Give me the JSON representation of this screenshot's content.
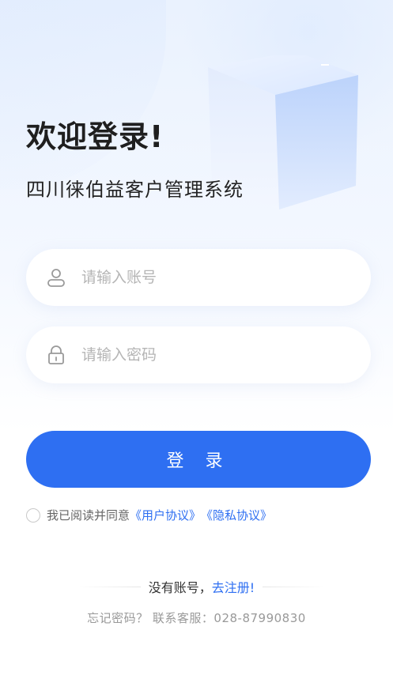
{
  "header": {
    "welcome": "欢迎登录!",
    "subtitle": "四川徕伯益客户管理系统"
  },
  "form": {
    "account": {
      "placeholder": "请输入账号",
      "icon": "user-icon"
    },
    "password": {
      "placeholder": "请输入密码",
      "icon": "lock-icon"
    },
    "login_label": "登 录"
  },
  "agreement": {
    "prefix": "我已阅读并同意",
    "user_agreement": "《用户协议》",
    "privacy_agreement": "《隐私协议》",
    "checked": false
  },
  "register": {
    "prompt": "没有账号，",
    "link": "去注册!"
  },
  "footer": {
    "forgot": "忘记密码？ 联系客服：028-87990830"
  },
  "colors": {
    "accent": "#2e6ff2",
    "placeholder": "#b5b5b5"
  }
}
